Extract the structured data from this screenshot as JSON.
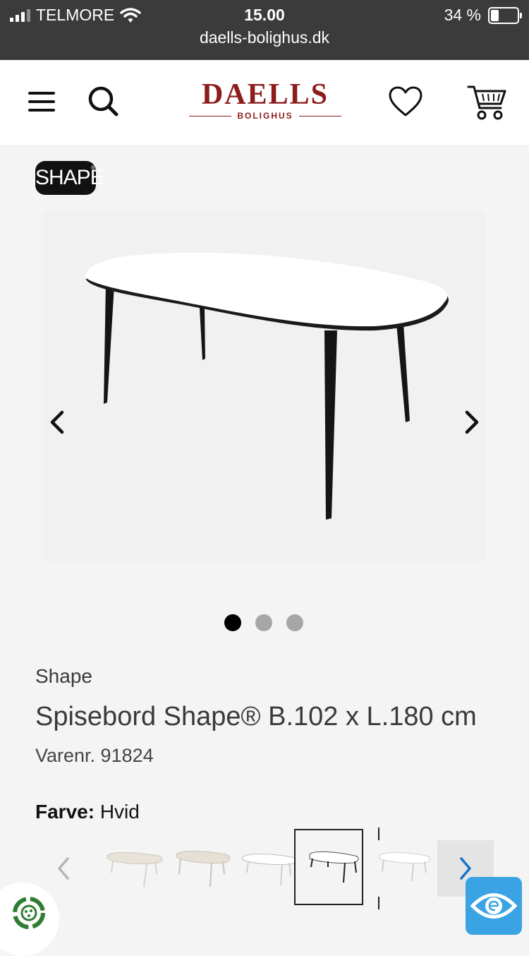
{
  "status_bar": {
    "carrier": "TELMORE",
    "time": "15.00",
    "battery": "34 %",
    "battery_level": 0.34,
    "url": "daells-bolighus.dk"
  },
  "header": {
    "logo_text": "DAELLS",
    "logo_subtext": "BOLIGHUS"
  },
  "brand_badge": {
    "text": "SHAPE",
    "mark": "®"
  },
  "gallery": {
    "image_icon": "white-oval-dining-table-black-legs",
    "current_index": 1,
    "total_images": 3
  },
  "product": {
    "brand": "Shape",
    "title": "Spisebord Shape® B.102 x L.180 cm",
    "sku": "Varenr. 91824",
    "color_label": "Farve:",
    "color_value": "Hvid"
  },
  "variants": [
    {
      "top_color": "#e8e3d9",
      "leg_color": "#d4d4d4",
      "selected": false
    },
    {
      "top_color": "#e6e0d4",
      "leg_color": "#c9c4bb",
      "selected": false
    },
    {
      "top_color": "#ffffff",
      "leg_color": "#cfcfcf",
      "selected": false
    },
    {
      "top_color": "#ffffff",
      "leg_color": "#222222",
      "selected": true
    },
    {
      "top_color": "#ffffff",
      "leg_color": "#cfcfcf",
      "selected": false
    }
  ],
  "colors": {
    "status_bar_bg": "#3b3b3b",
    "logo_red": "#8d1c1c",
    "eye_button_blue": "#3aa3e3",
    "eco_green": "#2e7d32"
  }
}
